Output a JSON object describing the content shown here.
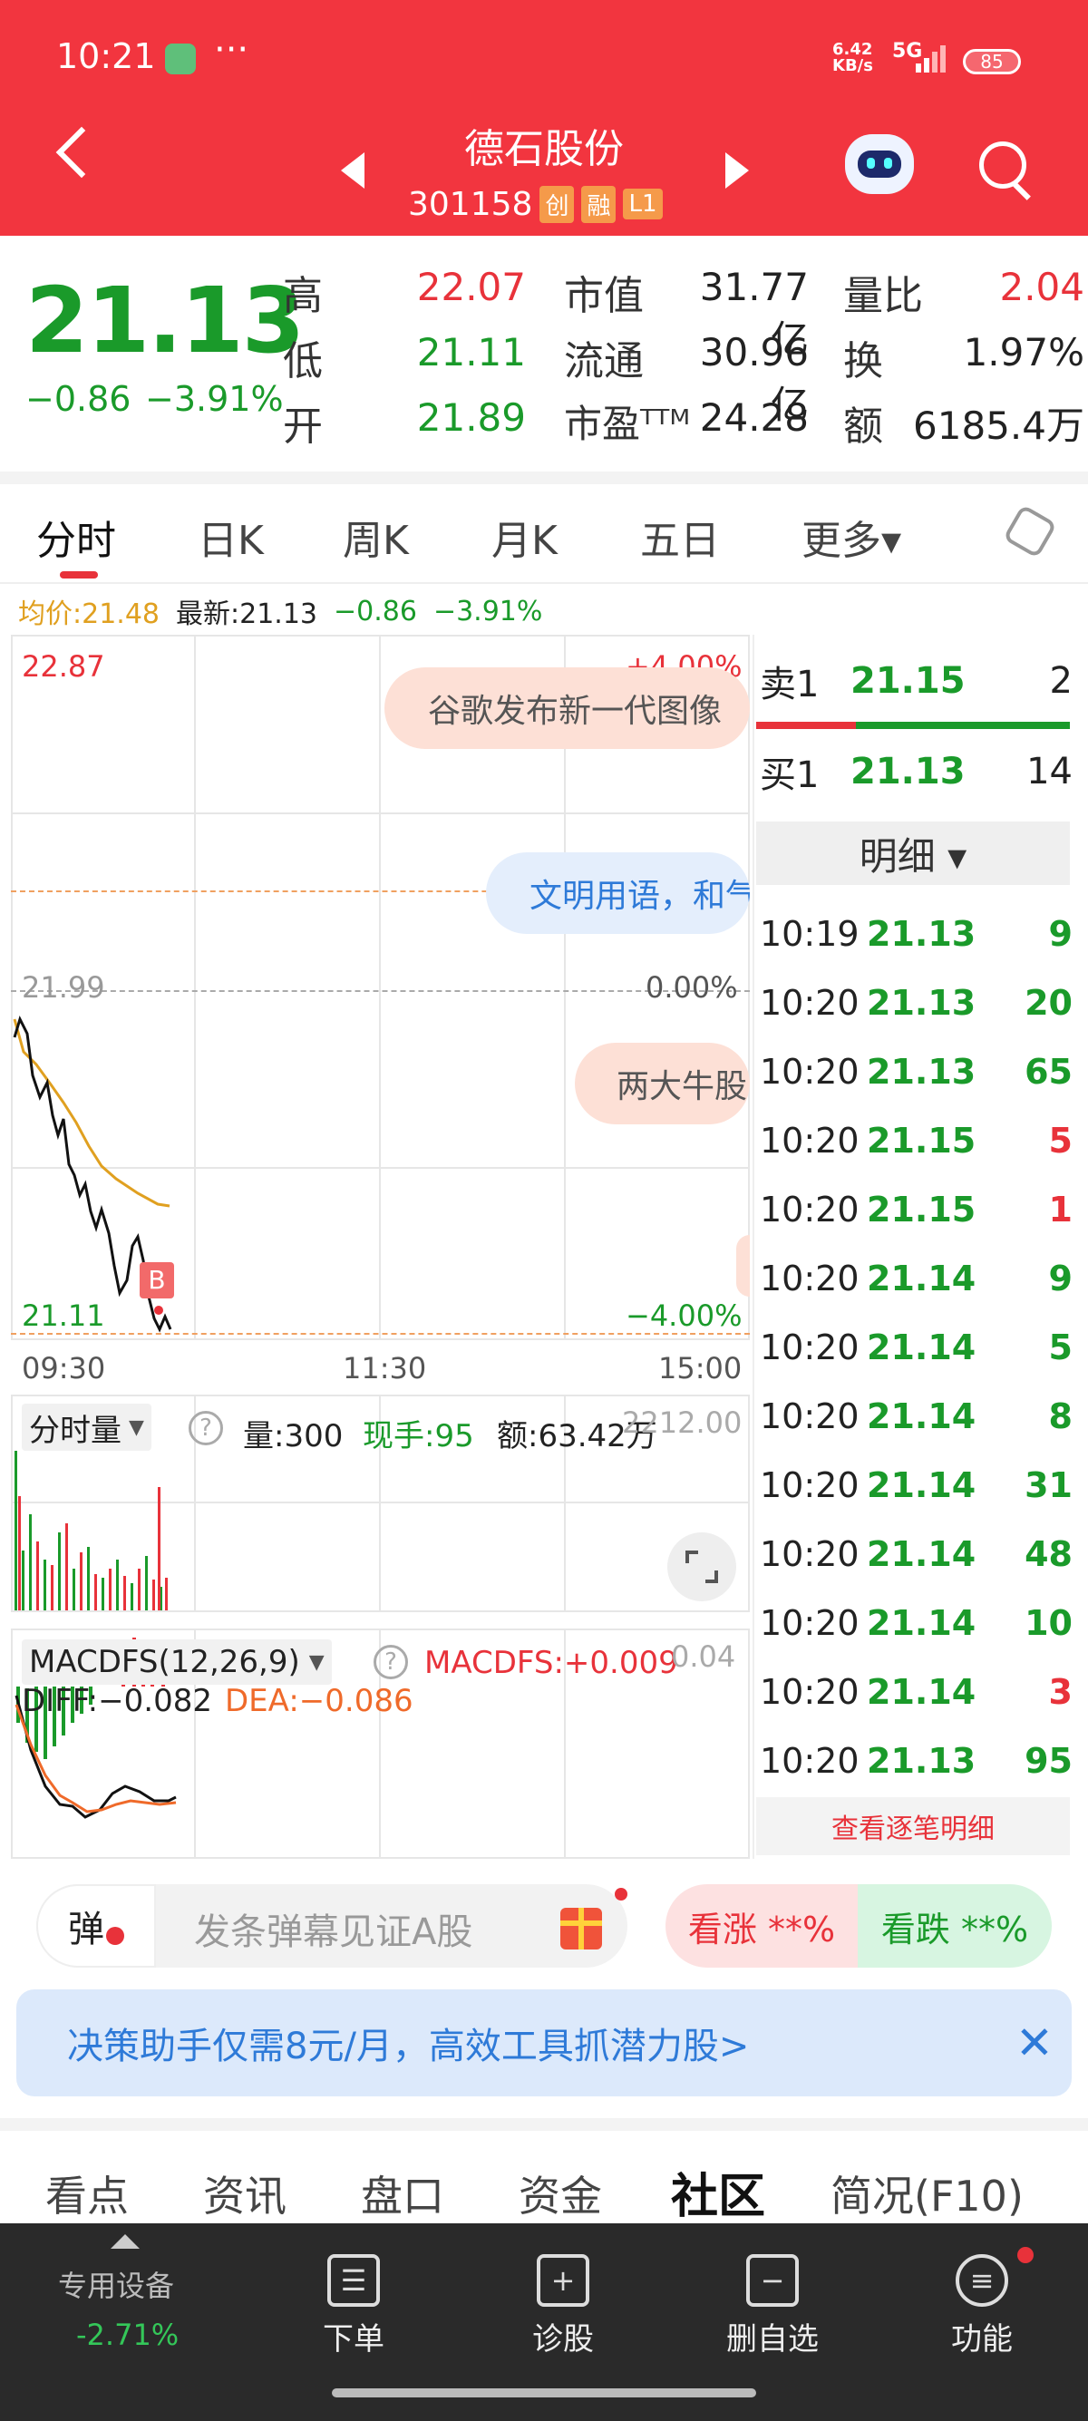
{
  "status_bar": {
    "time": "10:21",
    "net_speed": "6.42\nKB/s",
    "signal": "5G",
    "battery": "85"
  },
  "header": {
    "title": "德石股份",
    "code": "301158",
    "badges": [
      "创",
      "融",
      "L1"
    ]
  },
  "quote": {
    "price": "21.13",
    "change": "−0.86",
    "change_pct": "−3.91%",
    "rows": [
      {
        "l1": "高",
        "v1": "22.07",
        "l2": "市值",
        "v2": "31.77亿",
        "l3": "量比",
        "v3": "2.04"
      },
      {
        "l1": "低",
        "v1": "21.11",
        "l2": "流通",
        "v2": "30.96亿",
        "l3": "换",
        "v3": "1.97%"
      },
      {
        "l1": "开",
        "v1": "21.89",
        "l2": "市盈ᵀᵀᴹ",
        "v2": "24.28",
        "l3": "额",
        "v3": "6185.4万"
      }
    ]
  },
  "kline_tabs": [
    "分时",
    "日K",
    "周K",
    "月K",
    "五日",
    "更多▾"
  ],
  "chart_info": {
    "avg": "均价:21.48",
    "latest": "最新:21.13",
    "chg": "−0.86",
    "pct": "−3.91%"
  },
  "chart": {
    "y_top": "22.87",
    "y_mid": "21.99",
    "y_low": "21.11",
    "pct_top": "+4.00%",
    "pct_mid": "0.00%",
    "pct_low": "−4.00%",
    "x_labels": [
      "09:30",
      "11:30",
      "15:00"
    ],
    "bubbles": [
      "谷歌发布新一代图像",
      "文明用语，和气",
      "两大牛股"
    ],
    "marker": "B"
  },
  "volume": {
    "label": "分时量",
    "vol": "量:300",
    "hand": "现手:95",
    "amt": "额:63.42万",
    "max": "2212.00"
  },
  "macd": {
    "label": "MACDFS(12,26,9)",
    "macdfs": "MACDFS:+0.009",
    "max": "0.04",
    "diff": "DIFF:−0.082",
    "dea": "DEA:−0.086"
  },
  "orderbook": {
    "sell1": {
      "label": "卖1",
      "price": "21.15",
      "vol": "2"
    },
    "buy1": {
      "label": "买1",
      "price": "21.13",
      "vol": "14"
    },
    "detail_label": "明细 ▾",
    "trades": [
      {
        "t": "10:19",
        "p": "21.13",
        "v": "9",
        "c": "green"
      },
      {
        "t": "10:20",
        "p": "21.13",
        "v": "20",
        "c": "green"
      },
      {
        "t": "10:20",
        "p": "21.13",
        "v": "65",
        "c": "green"
      },
      {
        "t": "10:20",
        "p": "21.15",
        "v": "5",
        "c": "red"
      },
      {
        "t": "10:20",
        "p": "21.15",
        "v": "1",
        "c": "red"
      },
      {
        "t": "10:20",
        "p": "21.14",
        "v": "9",
        "c": "green"
      },
      {
        "t": "10:20",
        "p": "21.14",
        "v": "5",
        "c": "green"
      },
      {
        "t": "10:20",
        "p": "21.14",
        "v": "8",
        "c": "green"
      },
      {
        "t": "10:20",
        "p": "21.14",
        "v": "31",
        "c": "green"
      },
      {
        "t": "10:20",
        "p": "21.14",
        "v": "48",
        "c": "green"
      },
      {
        "t": "10:20",
        "p": "21.14",
        "v": "10",
        "c": "green"
      },
      {
        "t": "10:20",
        "p": "21.14",
        "v": "3",
        "c": "red"
      },
      {
        "t": "10:20",
        "p": "21.13",
        "v": "95",
        "c": "green"
      }
    ],
    "more_link": "查看逐笔明细"
  },
  "danmu": {
    "icon_label": "弹",
    "placeholder": "发条弹幕见证A股",
    "up": "看涨 **%",
    "down": "看跌 **%"
  },
  "promo": {
    "text": "决策助手仅需8元/月，高效工具抓潜力股>"
  },
  "content_tabs": [
    "看点",
    "资讯",
    "盘口",
    "资金",
    "社区",
    "简况(F10)"
  ],
  "bottom_nav": {
    "device": "专用设备",
    "device_pct": "-2.71%",
    "items": [
      "下单",
      "诊股",
      "删自选",
      "功能"
    ]
  },
  "colors": {
    "brand_red": "#f2353f",
    "up_red": "#e8323a",
    "down_green": "#1a9a2a",
    "avg_line": "#e0a020"
  }
}
